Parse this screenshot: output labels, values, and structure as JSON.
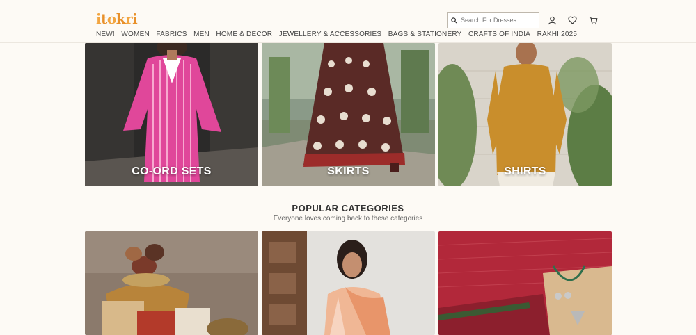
{
  "header": {
    "logo": "itokri",
    "search_placeholder": "Search For Dresses",
    "icons": [
      "account-icon",
      "wishlist-icon",
      "cart-icon"
    ]
  },
  "nav": [
    "NEW!",
    "WOMEN",
    "FABRICS",
    "MEN",
    "HOME & DECOR",
    "JEWELLERY & ACCESSORIES",
    "BAGS & STATIONERY",
    "CRAFTS OF INDIA",
    "RAKHI 2025"
  ],
  "featured_tiles": [
    {
      "label": "CO-ORD SETS"
    },
    {
      "label": "SKIRTS"
    },
    {
      "label": "SHIRTS"
    }
  ],
  "popular": {
    "title": "POPULAR CATEGORIES",
    "subtitle": "Everyone loves coming back to these categories"
  },
  "colors": {
    "background": "#fdfaf5",
    "logo_orange": "#f2a541",
    "nav_text": "#444444"
  }
}
